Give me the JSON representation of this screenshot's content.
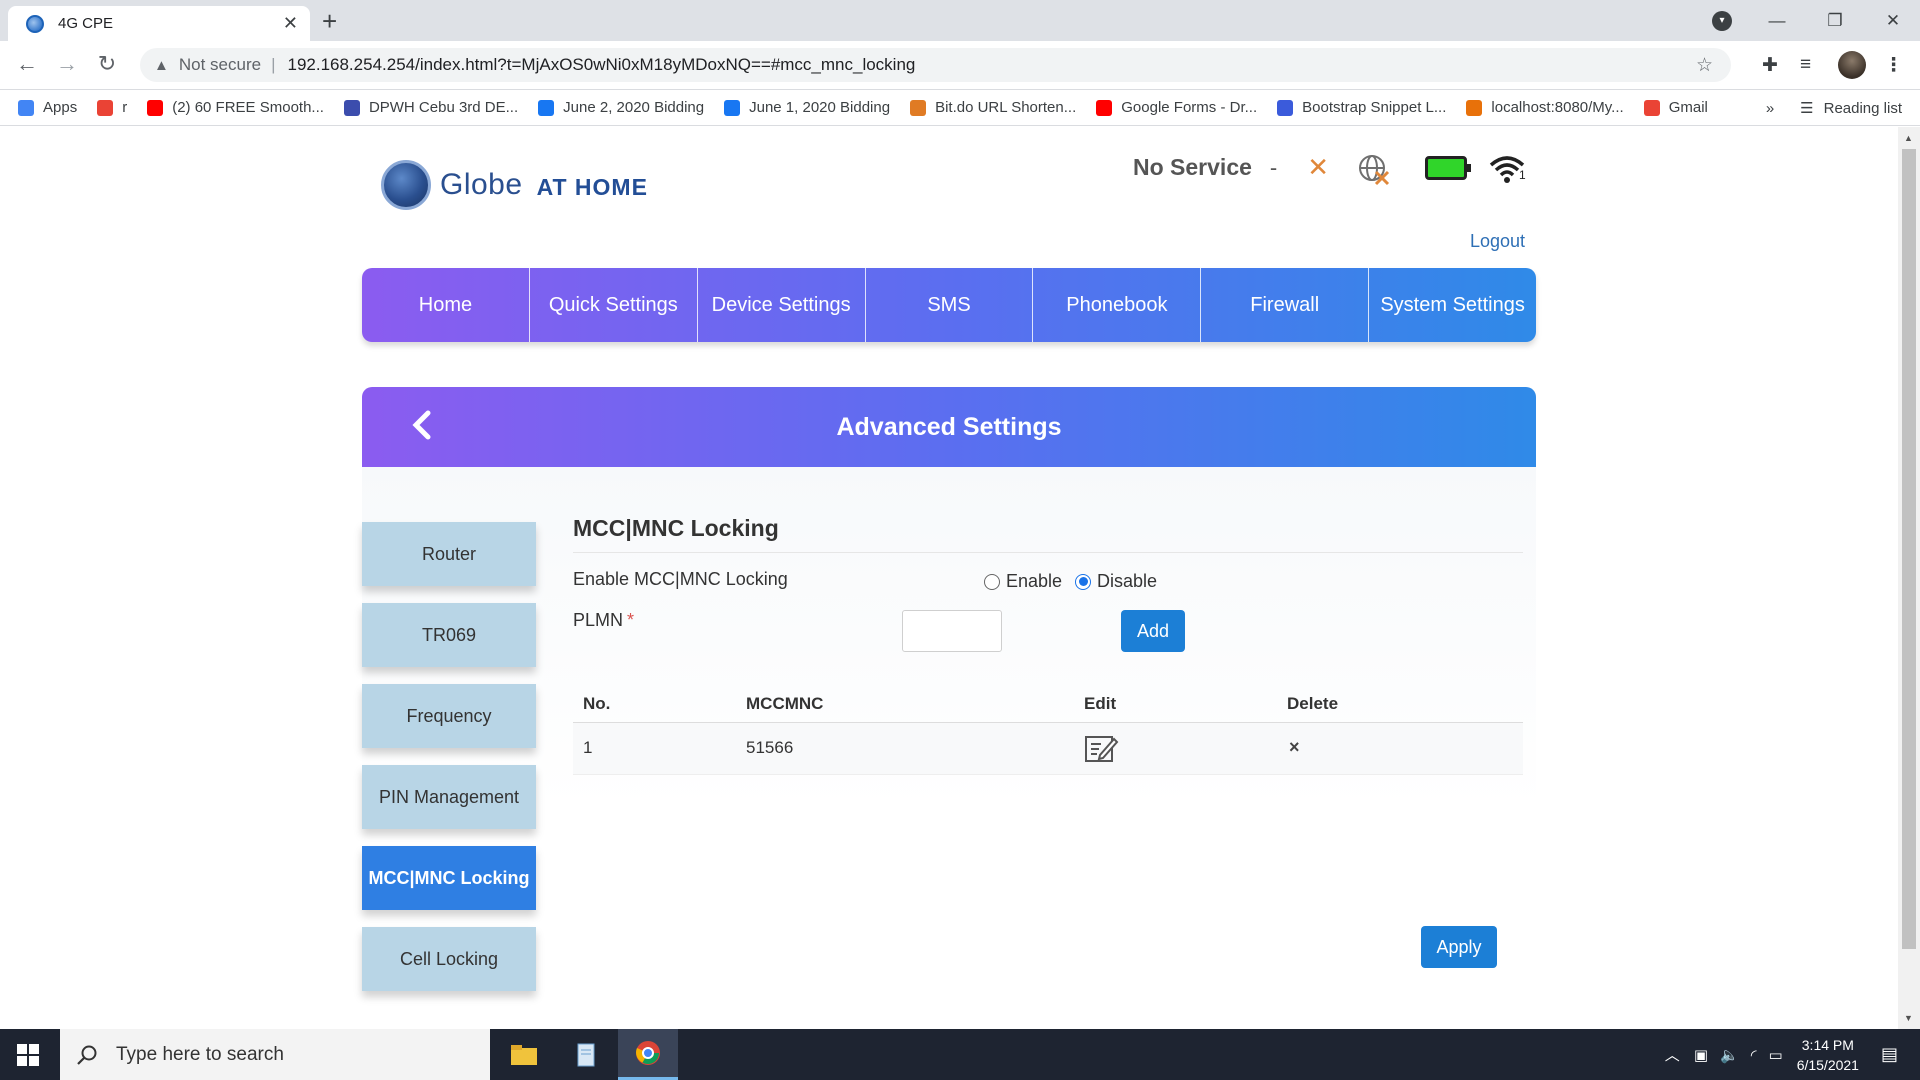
{
  "browser": {
    "tab_title": "4G CPE",
    "tab_close": "✕",
    "new_tab": "+",
    "not_secure": "Not secure",
    "url": "192.168.254.254/index.html?t=MjAxOS0wNi0xM18yMDoxNQ==#mcc_mnc_locking",
    "bookmarks": [
      {
        "label": "Apps",
        "icon": "apps-grid-icon",
        "color": "#4285f4"
      },
      {
        "label": "r",
        "icon": "google-icon",
        "color": "#ea4335"
      },
      {
        "label": "(2) 60 FREE Smooth...",
        "icon": "youtube-icon",
        "color": "#ff0000"
      },
      {
        "label": "DPWH Cebu 3rd DE...",
        "icon": "list-icon",
        "color": "#3c4dad"
      },
      {
        "label": "June 2, 2020 Bidding",
        "icon": "facebook-icon",
        "color": "#1877f2"
      },
      {
        "label": "June 1, 2020 Bidding",
        "icon": "facebook-icon",
        "color": "#1877f2"
      },
      {
        "label": "Bit.do URL Shorten...",
        "icon": "bitdo-icon",
        "color": "#e07b24"
      },
      {
        "label": "Google Forms - Dr...",
        "icon": "youtube-icon",
        "color": "#ff0000"
      },
      {
        "label": "Bootstrap Snippet L...",
        "icon": "bootstrap-icon",
        "color": "#3b5bdb"
      },
      {
        "label": "localhost:8080/My...",
        "icon": "localhost-icon",
        "color": "#e8710a"
      },
      {
        "label": "Gmail",
        "icon": "gmail-icon",
        "color": "#ea4335"
      }
    ],
    "more": "»",
    "reading_list": "Reading list"
  },
  "router": {
    "brand": "Globe",
    "brand_sub": "AT HOME",
    "status_text": "No Service",
    "status_dash": "-",
    "wifi_clients": "1",
    "logout": "Logout",
    "nav": [
      "Home",
      "Quick Settings",
      "Device Settings",
      "SMS",
      "Phonebook",
      "Firewall",
      "System Settings"
    ],
    "header_title": "Advanced Settings",
    "side_items": [
      {
        "label": "Router",
        "active": false
      },
      {
        "label": "TR069",
        "active": false
      },
      {
        "label": "Frequency",
        "active": false
      },
      {
        "label": "PIN Management",
        "active": false
      },
      {
        "label": "MCC|MNC Locking",
        "active": true
      },
      {
        "label": "Cell Locking",
        "active": false
      }
    ],
    "section_title": "MCC|MNC Locking",
    "enable_label": "Enable MCC|MNC Locking",
    "radio_enable": "Enable",
    "radio_disable": "Disable",
    "radio_selected": "Disable",
    "plmn_label": "PLMN",
    "required_mark": "*",
    "plmn_value": "",
    "add_button": "Add",
    "table_headers": [
      "No.",
      "MCCMNC",
      "Edit",
      "Delete"
    ],
    "table_rows": [
      {
        "no": "1",
        "mccmnc": "51566"
      }
    ],
    "delete_glyph": "×",
    "apply_button": "Apply"
  },
  "taskbar": {
    "search_placeholder": "Type here to search",
    "time": "3:14 PM",
    "date": "6/15/2021"
  },
  "colors": {
    "nav_gradient_start": "#8b5cf0",
    "nav_gradient_end": "#2f8ae8",
    "sidebar_inactive": "#b8d5e6",
    "sidebar_active": "#2f7fe3",
    "button_blue": "#1c7fd6",
    "battery_green": "#30d52a"
  }
}
